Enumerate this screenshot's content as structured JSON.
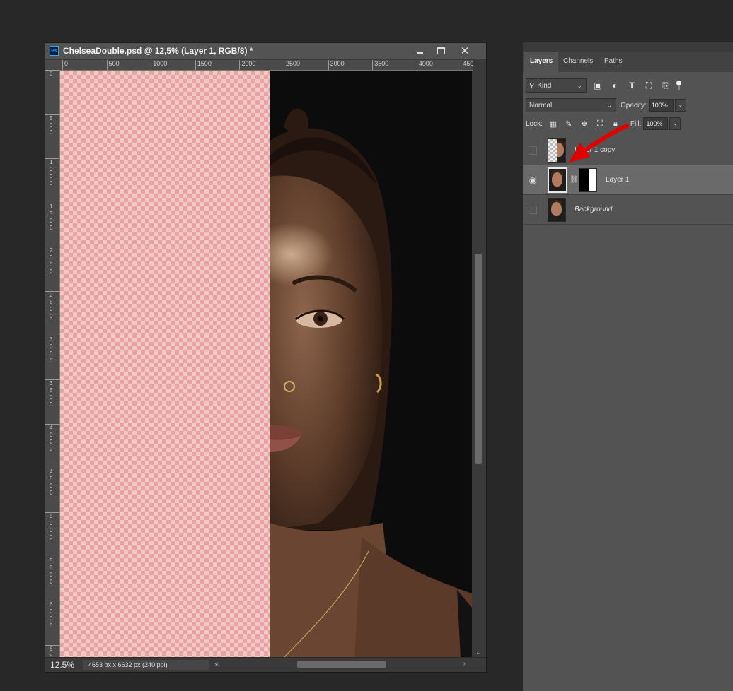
{
  "document": {
    "title": "ChelseaDouble.psd @ 12,5% (Layer 1, RGB/8) *",
    "app_icon": "Ps",
    "zoom": "12.5%",
    "info": "4653 px x 6632 px (240 ppi)",
    "ruler_h": [
      "0",
      "500",
      "1000",
      "1500",
      "2000",
      "2500",
      "3000",
      "3500",
      "4000",
      "450"
    ],
    "ruler_v": [
      "0",
      "5\n0\n0",
      "1\n0\n0\n0",
      "1\n5\n0\n0",
      "2\n0\n0\n0",
      "2\n5\n0\n0",
      "3\n0\n0\n0",
      "3\n5\n0\n0",
      "4\n0\n0\n0",
      "4\n5\n0\n0",
      "5\n0\n0\n0",
      "5\n5\n0\n0",
      "6\n0\n0\n0",
      "6\n5"
    ]
  },
  "panel": {
    "tabs": [
      "Layers",
      "Channels",
      "Paths"
    ],
    "filter": {
      "kind": "Kind"
    },
    "blend_mode": "Normal",
    "opacity_label": "Opacity:",
    "opacity_value": "100%",
    "lock_label": "Lock:",
    "fill_label": "Fill:",
    "fill_value": "100%",
    "layers": [
      {
        "name": "Layer 1 copy",
        "visible": false,
        "selected": false
      },
      {
        "name": "Layer 1",
        "visible": true,
        "selected": true,
        "has_mask": true
      },
      {
        "name": "Background",
        "visible": false,
        "selected": false,
        "italic": true
      }
    ]
  },
  "colors": {
    "annotation_arrow": "#e00000",
    "selection_highlight": "#6a6a6a"
  }
}
